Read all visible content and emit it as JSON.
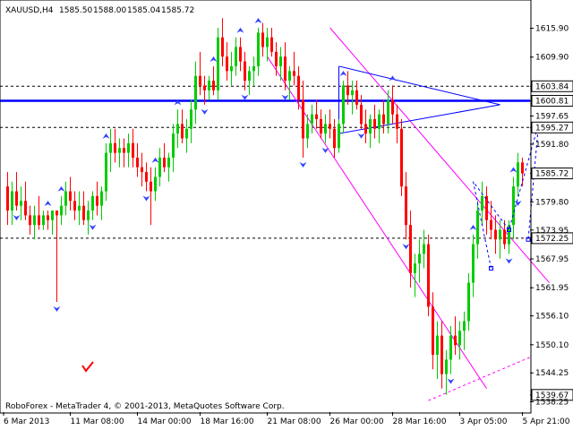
{
  "header": {
    "symbol": "XAUUSD,H4",
    "ohlc": [
      "1585.50",
      "1588.00",
      "1585.04",
      "1585.72"
    ]
  },
  "footer": {
    "copyright": "RoboForex - MetaTrader 4, © 2001-2013, MetaQuotes Software Corp."
  },
  "chart_data": {
    "type": "candlestick",
    "ylim": [
      1536.1,
      1621.4
    ],
    "price_ticks": [
      "1615.90",
      "1609.90",
      "1603.84",
      "1600.81",
      "1597.65",
      "1595.27",
      "1591.80",
      "1585.72",
      "1579.80",
      "1573.95",
      "1572.25",
      "1567.95",
      "1561.95",
      "1556.10",
      "1550.10",
      "1544.25",
      "1539.67",
      "1538.25"
    ],
    "highlighted_levels": [
      {
        "value": "1603.84",
        "kind": "dashed",
        "color": "#000000"
      },
      {
        "value": "1600.81",
        "kind": "solid",
        "color": "#0000ff"
      },
      {
        "value": "1595.27",
        "kind": "dashed",
        "color": "#000000"
      },
      {
        "value": "1585.72",
        "kind": "current",
        "color": "#000000"
      },
      {
        "value": "1572.25",
        "kind": "dashed",
        "color": "#000000"
      },
      {
        "value": "1539.67",
        "kind": "label",
        "color": "#000000"
      }
    ],
    "time_labels": [
      "6 Mar 2013",
      "11 Mar 08:00",
      "14 Mar 00:00",
      "18 Mar 16:00",
      "21 Mar 08:00",
      "26 Mar 00:00",
      "28 Mar 16:00",
      "3 Apr 05:00",
      "5 Apr 21:00"
    ],
    "bull_color": "#00cc00",
    "bear_color": "#ff0000",
    "line_colors": {
      "channel": "#ff00ff",
      "triangle": "#0000ff",
      "forecast": "#0000ff"
    },
    "candles": [
      {
        "o": 1583,
        "h": 1586,
        "l": 1575,
        "c": 1578
      },
      {
        "o": 1578,
        "h": 1584,
        "l": 1575,
        "c": 1582
      },
      {
        "o": 1582,
        "h": 1586,
        "l": 1578,
        "c": 1579
      },
      {
        "o": 1579,
        "h": 1583,
        "l": 1576,
        "c": 1580
      },
      {
        "o": 1580,
        "h": 1584,
        "l": 1576,
        "c": 1577
      },
      {
        "o": 1577,
        "h": 1579,
        "l": 1573,
        "c": 1575
      },
      {
        "o": 1575,
        "h": 1579,
        "l": 1572,
        "c": 1577
      },
      {
        "o": 1577,
        "h": 1581,
        "l": 1574,
        "c": 1575
      },
      {
        "o": 1575,
        "h": 1578,
        "l": 1574,
        "c": 1577
      },
      {
        "o": 1577,
        "h": 1578,
        "l": 1574,
        "c": 1576
      },
      {
        "o": 1576,
        "h": 1578,
        "l": 1573,
        "c": 1578
      },
      {
        "o": 1578,
        "h": 1578,
        "l": 1559,
        "c": 1577
      },
      {
        "o": 1577,
        "h": 1581,
        "l": 1575,
        "c": 1579
      },
      {
        "o": 1579,
        "h": 1584,
        "l": 1577,
        "c": 1582
      },
      {
        "o": 1582,
        "h": 1585,
        "l": 1578,
        "c": 1580
      },
      {
        "o": 1580,
        "h": 1582,
        "l": 1576,
        "c": 1578
      },
      {
        "o": 1578,
        "h": 1582,
        "l": 1575,
        "c": 1579
      },
      {
        "o": 1579,
        "h": 1582,
        "l": 1575,
        "c": 1576
      },
      {
        "o": 1576,
        "h": 1580,
        "l": 1573,
        "c": 1578
      },
      {
        "o": 1578,
        "h": 1582,
        "l": 1576,
        "c": 1581
      },
      {
        "o": 1581,
        "h": 1584,
        "l": 1577,
        "c": 1579
      },
      {
        "o": 1579,
        "h": 1583,
        "l": 1576,
        "c": 1582
      },
      {
        "o": 1582,
        "h": 1592,
        "l": 1580,
        "c": 1590
      },
      {
        "o": 1590,
        "h": 1595,
        "l": 1586,
        "c": 1592
      },
      {
        "o": 1592,
        "h": 1595,
        "l": 1588,
        "c": 1590
      },
      {
        "o": 1590,
        "h": 1593,
        "l": 1587,
        "c": 1591
      },
      {
        "o": 1591,
        "h": 1593,
        "l": 1587,
        "c": 1590
      },
      {
        "o": 1590,
        "h": 1594,
        "l": 1587,
        "c": 1592
      },
      {
        "o": 1592,
        "h": 1595,
        "l": 1587,
        "c": 1589
      },
      {
        "o": 1589,
        "h": 1592,
        "l": 1585,
        "c": 1587
      },
      {
        "o": 1587,
        "h": 1590,
        "l": 1583,
        "c": 1586
      },
      {
        "o": 1586,
        "h": 1588,
        "l": 1582,
        "c": 1584
      },
      {
        "o": 1584,
        "h": 1587,
        "l": 1575,
        "c": 1582
      },
      {
        "o": 1582,
        "h": 1587,
        "l": 1580,
        "c": 1585
      },
      {
        "o": 1585,
        "h": 1591,
        "l": 1583,
        "c": 1589
      },
      {
        "o": 1589,
        "h": 1592,
        "l": 1586,
        "c": 1587
      },
      {
        "o": 1587,
        "h": 1590,
        "l": 1584,
        "c": 1589
      },
      {
        "o": 1589,
        "h": 1596,
        "l": 1586,
        "c": 1594
      },
      {
        "o": 1594,
        "h": 1599,
        "l": 1591,
        "c": 1596
      },
      {
        "o": 1596,
        "h": 1599,
        "l": 1592,
        "c": 1593
      },
      {
        "o": 1593,
        "h": 1597,
        "l": 1590,
        "c": 1595
      },
      {
        "o": 1595,
        "h": 1601,
        "l": 1592,
        "c": 1599
      },
      {
        "o": 1599,
        "h": 1609,
        "l": 1596,
        "c": 1606
      },
      {
        "o": 1606,
        "h": 1611,
        "l": 1602,
        "c": 1604
      },
      {
        "o": 1604,
        "h": 1606,
        "l": 1600,
        "c": 1603
      },
      {
        "o": 1603,
        "h": 1606,
        "l": 1601,
        "c": 1605
      },
      {
        "o": 1605,
        "h": 1608,
        "l": 1602,
        "c": 1603
      },
      {
        "o": 1603,
        "h": 1616,
        "l": 1601,
        "c": 1614
      },
      {
        "o": 1614,
        "h": 1618,
        "l": 1608,
        "c": 1610
      },
      {
        "o": 1610,
        "h": 1613,
        "l": 1605,
        "c": 1607
      },
      {
        "o": 1607,
        "h": 1611,
        "l": 1604,
        "c": 1608
      },
      {
        "o": 1608,
        "h": 1614,
        "l": 1606,
        "c": 1612
      },
      {
        "o": 1612,
        "h": 1614,
        "l": 1607,
        "c": 1609
      },
      {
        "o": 1609,
        "h": 1611,
        "l": 1603,
        "c": 1605
      },
      {
        "o": 1605,
        "h": 1608,
        "l": 1602,
        "c": 1607
      },
      {
        "o": 1607,
        "h": 1610,
        "l": 1604,
        "c": 1608
      },
      {
        "o": 1608,
        "h": 1616,
        "l": 1606,
        "c": 1615
      },
      {
        "o": 1615,
        "h": 1617,
        "l": 1610,
        "c": 1612
      },
      {
        "o": 1612,
        "h": 1616,
        "l": 1609,
        "c": 1614
      },
      {
        "o": 1614,
        "h": 1616,
        "l": 1610,
        "c": 1611
      },
      {
        "o": 1611,
        "h": 1613,
        "l": 1606,
        "c": 1608
      },
      {
        "o": 1608,
        "h": 1612,
        "l": 1605,
        "c": 1610
      },
      {
        "o": 1610,
        "h": 1613,
        "l": 1603,
        "c": 1605
      },
      {
        "o": 1605,
        "h": 1608,
        "l": 1601,
        "c": 1607
      },
      {
        "o": 1607,
        "h": 1611,
        "l": 1604,
        "c": 1606
      },
      {
        "o": 1606,
        "h": 1608,
        "l": 1599,
        "c": 1601
      },
      {
        "o": 1601,
        "h": 1605,
        "l": 1589,
        "c": 1593
      },
      {
        "o": 1593,
        "h": 1598,
        "l": 1591,
        "c": 1596
      },
      {
        "o": 1596,
        "h": 1600,
        "l": 1594,
        "c": 1598
      },
      {
        "o": 1598,
        "h": 1601,
        "l": 1595,
        "c": 1597
      },
      {
        "o": 1597,
        "h": 1599,
        "l": 1593,
        "c": 1594
      },
      {
        "o": 1594,
        "h": 1598,
        "l": 1592,
        "c": 1596
      },
      {
        "o": 1596,
        "h": 1599,
        "l": 1593,
        "c": 1595
      },
      {
        "o": 1595,
        "h": 1597,
        "l": 1589,
        "c": 1591
      },
      {
        "o": 1591,
        "h": 1597,
        "l": 1590,
        "c": 1596
      },
      {
        "o": 1596,
        "h": 1605,
        "l": 1594,
        "c": 1604
      },
      {
        "o": 1604,
        "h": 1607,
        "l": 1600,
        "c": 1602
      },
      {
        "o": 1602,
        "h": 1605,
        "l": 1598,
        "c": 1603
      },
      {
        "o": 1603,
        "h": 1605,
        "l": 1599,
        "c": 1600
      },
      {
        "o": 1600,
        "h": 1602,
        "l": 1595,
        "c": 1596
      },
      {
        "o": 1596,
        "h": 1599,
        "l": 1592,
        "c": 1594
      },
      {
        "o": 1594,
        "h": 1598,
        "l": 1591,
        "c": 1597
      },
      {
        "o": 1597,
        "h": 1600,
        "l": 1593,
        "c": 1595
      },
      {
        "o": 1595,
        "h": 1599,
        "l": 1592,
        "c": 1598
      },
      {
        "o": 1598,
        "h": 1601,
        "l": 1594,
        "c": 1596
      },
      {
        "o": 1596,
        "h": 1603,
        "l": 1594,
        "c": 1601
      },
      {
        "o": 1601,
        "h": 1604,
        "l": 1596,
        "c": 1598
      },
      {
        "o": 1598,
        "h": 1600,
        "l": 1592,
        "c": 1595
      },
      {
        "o": 1595,
        "h": 1597,
        "l": 1581,
        "c": 1583
      },
      {
        "o": 1583,
        "h": 1586,
        "l": 1572,
        "c": 1575
      },
      {
        "o": 1575,
        "h": 1578,
        "l": 1562,
        "c": 1565
      },
      {
        "o": 1565,
        "h": 1569,
        "l": 1560,
        "c": 1567
      },
      {
        "o": 1567,
        "h": 1572,
        "l": 1563,
        "c": 1569
      },
      {
        "o": 1569,
        "h": 1574,
        "l": 1566,
        "c": 1571
      },
      {
        "o": 1571,
        "h": 1573,
        "l": 1556,
        "c": 1558
      },
      {
        "o": 1558,
        "h": 1561,
        "l": 1545,
        "c": 1548
      },
      {
        "o": 1548,
        "h": 1555,
        "l": 1543,
        "c": 1552
      },
      {
        "o": 1552,
        "h": 1555,
        "l": 1541,
        "c": 1544
      },
      {
        "o": 1544,
        "h": 1549,
        "l": 1539.67,
        "c": 1547
      },
      {
        "o": 1547,
        "h": 1554,
        "l": 1544,
        "c": 1552
      },
      {
        "o": 1552,
        "h": 1556,
        "l": 1548,
        "c": 1550
      },
      {
        "o": 1550,
        "h": 1555,
        "l": 1547,
        "c": 1553
      },
      {
        "o": 1553,
        "h": 1557,
        "l": 1549,
        "c": 1555
      },
      {
        "o": 1555,
        "h": 1565,
        "l": 1553,
        "c": 1563
      },
      {
        "o": 1563,
        "h": 1573,
        "l": 1560,
        "c": 1571
      },
      {
        "o": 1571,
        "h": 1580,
        "l": 1568,
        "c": 1578
      },
      {
        "o": 1578,
        "h": 1584,
        "l": 1575,
        "c": 1581
      },
      {
        "o": 1581,
        "h": 1583,
        "l": 1573,
        "c": 1576
      },
      {
        "o": 1576,
        "h": 1580,
        "l": 1572,
        "c": 1574
      },
      {
        "o": 1574,
        "h": 1577,
        "l": 1569,
        "c": 1572
      },
      {
        "o": 1572,
        "h": 1576,
        "l": 1568,
        "c": 1574
      },
      {
        "o": 1574,
        "h": 1576,
        "l": 1570,
        "c": 1571
      },
      {
        "o": 1571,
        "h": 1576,
        "l": 1569,
        "c": 1575
      },
      {
        "o": 1575,
        "h": 1585,
        "l": 1572,
        "c": 1583
      },
      {
        "o": 1583,
        "h": 1590,
        "l": 1581,
        "c": 1588
      },
      {
        "o": 1588,
        "h": 1589,
        "l": 1583,
        "c": 1585.72
      }
    ],
    "fractals_up": [
      9,
      12,
      22,
      33,
      38,
      46,
      52,
      56,
      75,
      86,
      104,
      113,
      118
    ],
    "fractals_down": [
      2,
      11,
      19,
      31,
      44,
      53,
      62,
      66,
      71,
      79,
      89,
      99,
      112,
      114,
      117
    ],
    "channel_lines": [
      {
        "from": [
          "21 Mar 08:00",
          1610
        ],
        "to": [
          "3 Apr 05:00",
          1541
        ]
      },
      {
        "from": [
          "26 Mar 00:00",
          1616
        ],
        "to": [
          "5 Apr 21:00",
          1563
        ]
      }
    ],
    "triangle": [
      [
        1608,
        1594
      ],
      [
        1600,
        1600
      ]
    ],
    "forecast_path": [
      1566,
      1584,
      1574,
      1596,
      1572
    ]
  }
}
